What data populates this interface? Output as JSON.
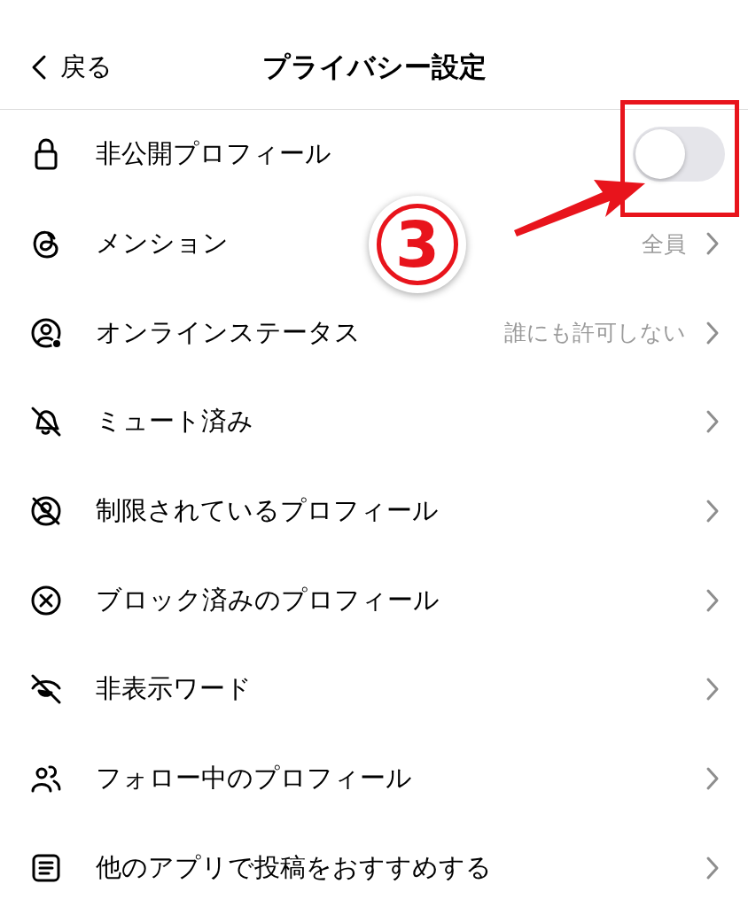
{
  "header": {
    "back": "戻る",
    "title": "プライバシー設定"
  },
  "items": [
    {
      "kind": "toggle",
      "label": "非公開プロフィール",
      "on": false
    },
    {
      "kind": "link",
      "label": "メンション",
      "value": "全員"
    },
    {
      "kind": "link",
      "label": "オンラインステータス",
      "value": "誰にも許可しない"
    },
    {
      "kind": "link",
      "label": "ミュート済み"
    },
    {
      "kind": "link",
      "label": "制限されているプロフィール"
    },
    {
      "kind": "link",
      "label": "ブロック済みのプロフィール"
    },
    {
      "kind": "link",
      "label": "非表示ワード"
    },
    {
      "kind": "link",
      "label": "フォロー中のプロフィール"
    },
    {
      "kind": "link",
      "label": "他のアプリで投稿をおすすめする"
    }
  ],
  "annotation": {
    "label": "3"
  }
}
